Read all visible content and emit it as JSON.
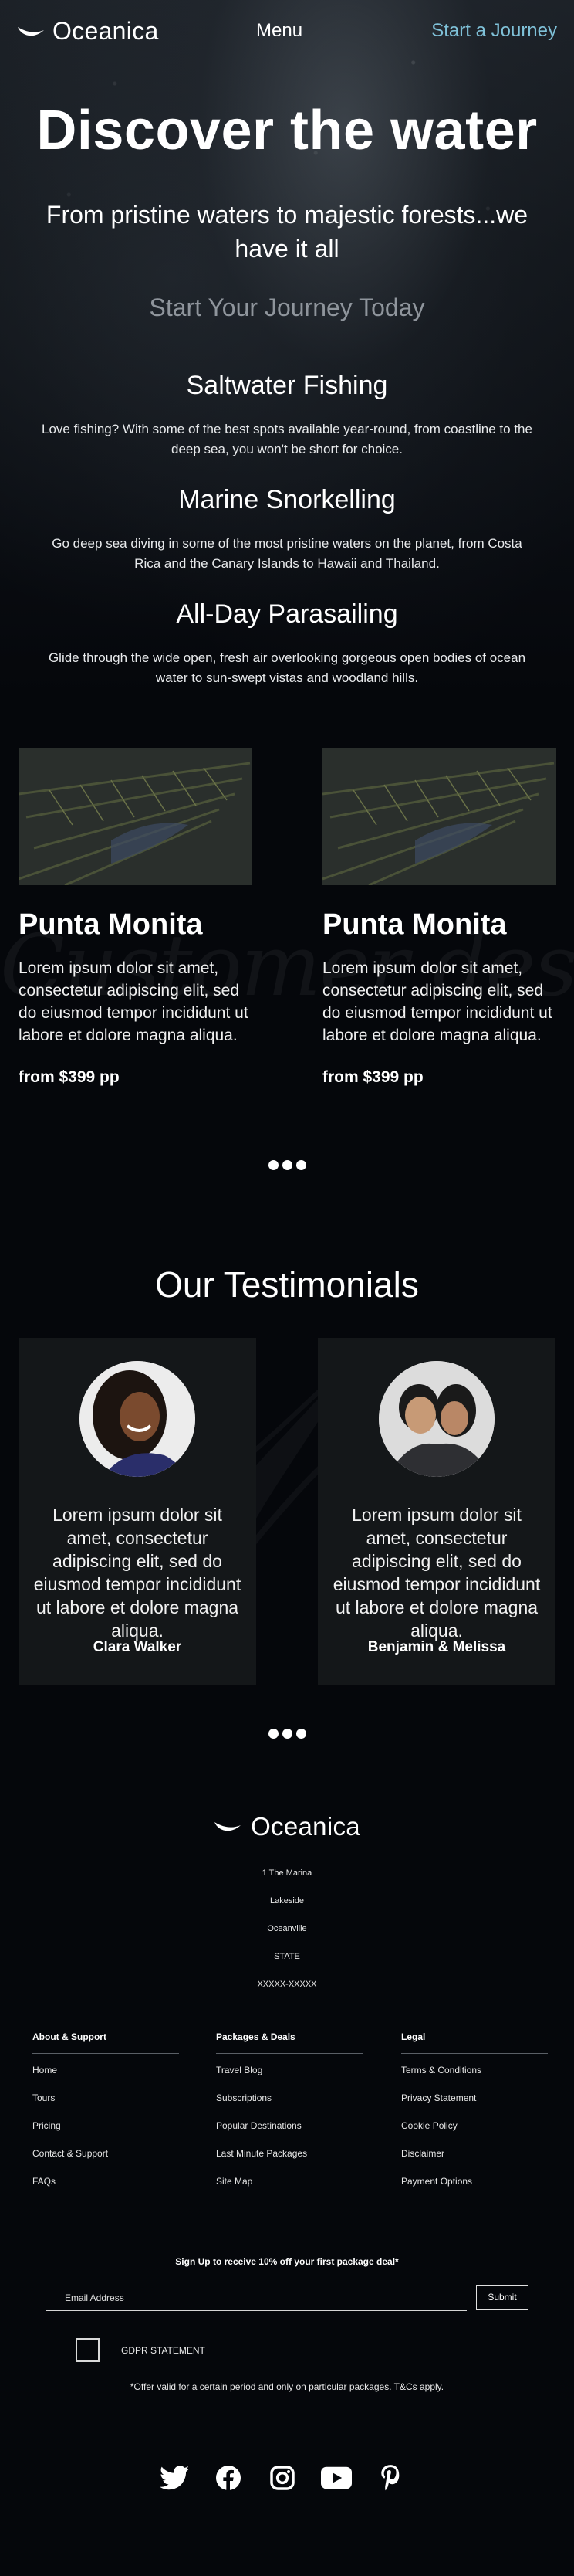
{
  "nav": {
    "brand": "Oceanica",
    "menu_label": "Menu",
    "cta_label": "Start a Journey"
  },
  "hero": {
    "title": "Discover the water",
    "subtitle": "From pristine waters to majestic forests...we have it all",
    "cta_label": "Start Your Journey Today"
  },
  "activities": [
    {
      "title": "Saltwater Fishing",
      "text": "Love fishing? With some of the best spots available year-round, from coastline to the deep sea, you won't be short for choice."
    },
    {
      "title": "Marine Snorkelling",
      "text": "Go deep sea diving in some of the most pristine waters on the planet, from Costa Rica and the Canary Islands to Hawaii and Thailand."
    },
    {
      "title": "All-Day Parasailing",
      "text": "Glide through the wide open, fresh air overlooking gorgeous open bodies of ocean water to sun-swept vistas and woodland hills."
    }
  ],
  "destinations": {
    "watermark": "Customer destinations",
    "cards": [
      {
        "name": "Punta Monita",
        "text": "Lorem ipsum dolor sit amet, consectetur adipiscing elit, sed do eiusmod tempor incididunt ut labore et dolore magna aliqua.",
        "price": "from $399 pp"
      },
      {
        "name": "Punta Monita",
        "text": "Lorem ipsum dolor sit amet, consectetur adipiscing elit, sed do eiusmod tempor incididunt ut labore et dolore magna aliqua.",
        "price": "from $399 pp"
      }
    ]
  },
  "testimonials": {
    "title": "Our Testimonials",
    "items": [
      {
        "text": "Lorem ipsum dolor sit amet, consectetur adipiscing elit, sed do eiusmod tempor incididunt ut labore et dolore magna aliqua.",
        "author": "Clara Walker"
      },
      {
        "text": "Lorem ipsum dolor sit amet, consectetur adipiscing elit, sed do eiusmod tempor incididunt ut labore et dolore magna aliqua.",
        "author": "Benjamin & Melissa"
      }
    ]
  },
  "footer": {
    "brand": "Oceanica",
    "address": [
      "1 The Marina",
      "Lakeside",
      "Oceanville",
      "STATE",
      "XXXXX-XXXXX"
    ],
    "columns": [
      {
        "heading": "About & Support",
        "links": [
          "Home",
          "Tours",
          "Pricing",
          "Contact & Support",
          "FAQs"
        ]
      },
      {
        "heading": "Packages & Deals",
        "links": [
          "Travel Blog",
          "Subscriptions",
          "Popular Destinations",
          "Last Minute Packages",
          "Site Map"
        ]
      },
      {
        "heading": "Legal",
        "links": [
          "Terms & Conditions",
          "Privacy Statement",
          "Cookie Policy",
          "Disclaimer",
          "Payment Options"
        ]
      }
    ],
    "signup": {
      "title": "Sign Up to receive 10% off your first package deal*",
      "email_placeholder": "Email Address",
      "submit_label": "Submit",
      "gdpr_label": "GDPR STATEMENT",
      "disclaimer": "*Offer valid for a certain period and only on particular packages. T&Cs apply."
    },
    "socials": [
      "twitter-icon",
      "facebook-icon",
      "instagram-icon",
      "youtube-icon",
      "pinterest-icon"
    ]
  },
  "colors": {
    "background": "#05070b",
    "accent": "#7fc1d8",
    "muted_cta": "#8f959c",
    "card": "#141719"
  }
}
